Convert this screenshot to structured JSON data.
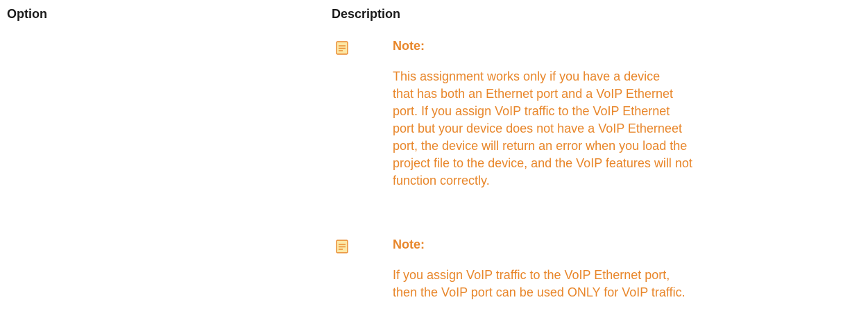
{
  "table": {
    "headers": {
      "option": "Option",
      "description": "Description"
    }
  },
  "notes": [
    {
      "icon": "note-icon",
      "title": "Note:",
      "lines": [
        "This assignment works only if you have a device",
        "that has both an Ethernet port and a VoIP Ethernet",
        "port. If you assign VoIP traffic to the VoIP Ethernet",
        "port but your device does not have a VoIP Etherneet",
        "port, the device will return an error when you load the",
        "project file to the device, and the VoIP features will not",
        "function correctly."
      ]
    },
    {
      "icon": "note-icon",
      "title": "Note:",
      "lines": [
        "If you assign VoIP traffic to the VoIP Ethernet port,",
        "then the VoIP port can be used ONLY for VoIP traffic."
      ]
    }
  ],
  "colors": {
    "note_text": "#e8862a",
    "header_text": "#1a1a1a",
    "icon_fill": "#fce8a6",
    "icon_stroke": "#e8862a"
  }
}
